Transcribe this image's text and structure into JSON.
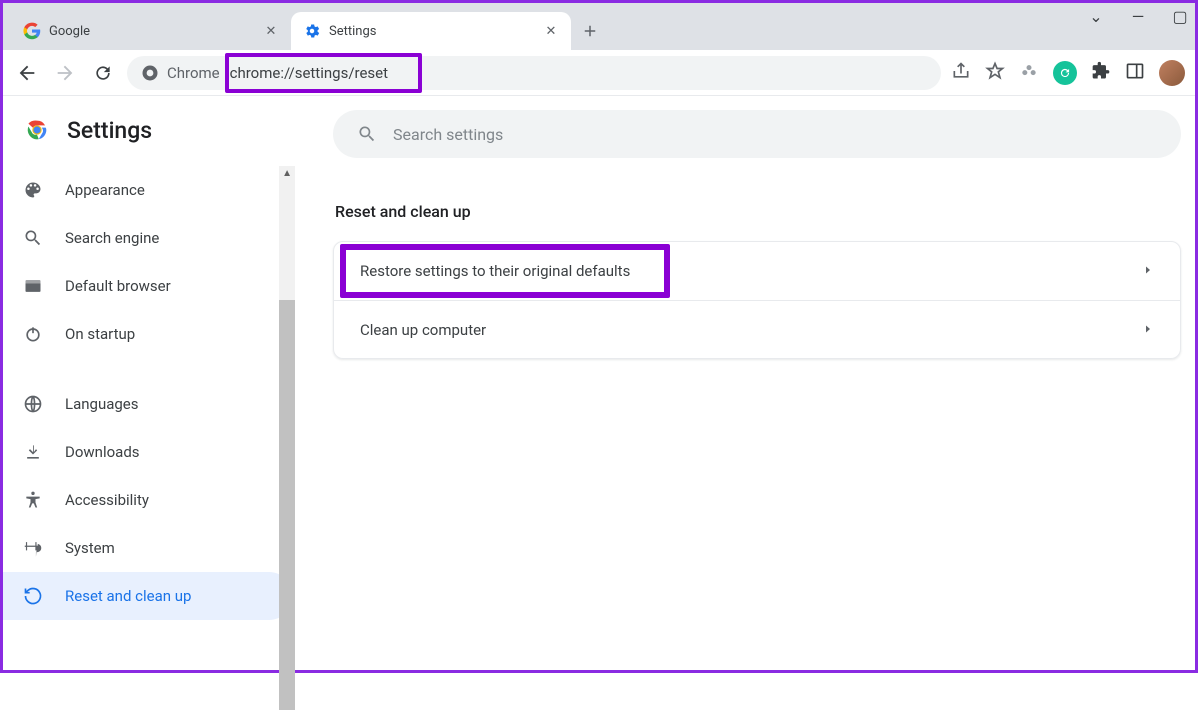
{
  "window": {
    "controls": {
      "expand": "⌄",
      "min": "—",
      "max": "▢"
    }
  },
  "tabs": [
    {
      "title": "Google",
      "active": false
    },
    {
      "title": "Settings",
      "active": true
    }
  ],
  "omnibox": {
    "chip": "Chrome",
    "url": "chrome://settings/reset"
  },
  "settings_title": "Settings",
  "search_placeholder": "Search settings",
  "sidebar": {
    "items": [
      {
        "label": "Appearance"
      },
      {
        "label": "Search engine"
      },
      {
        "label": "Default browser"
      },
      {
        "label": "On startup"
      },
      {
        "label": "Languages"
      },
      {
        "label": "Downloads"
      },
      {
        "label": "Accessibility"
      },
      {
        "label": "System"
      },
      {
        "label": "Reset and clean up"
      }
    ]
  },
  "section_title": "Reset and clean up",
  "rows": [
    {
      "label": "Restore settings to their original defaults"
    },
    {
      "label": "Clean up computer"
    }
  ]
}
